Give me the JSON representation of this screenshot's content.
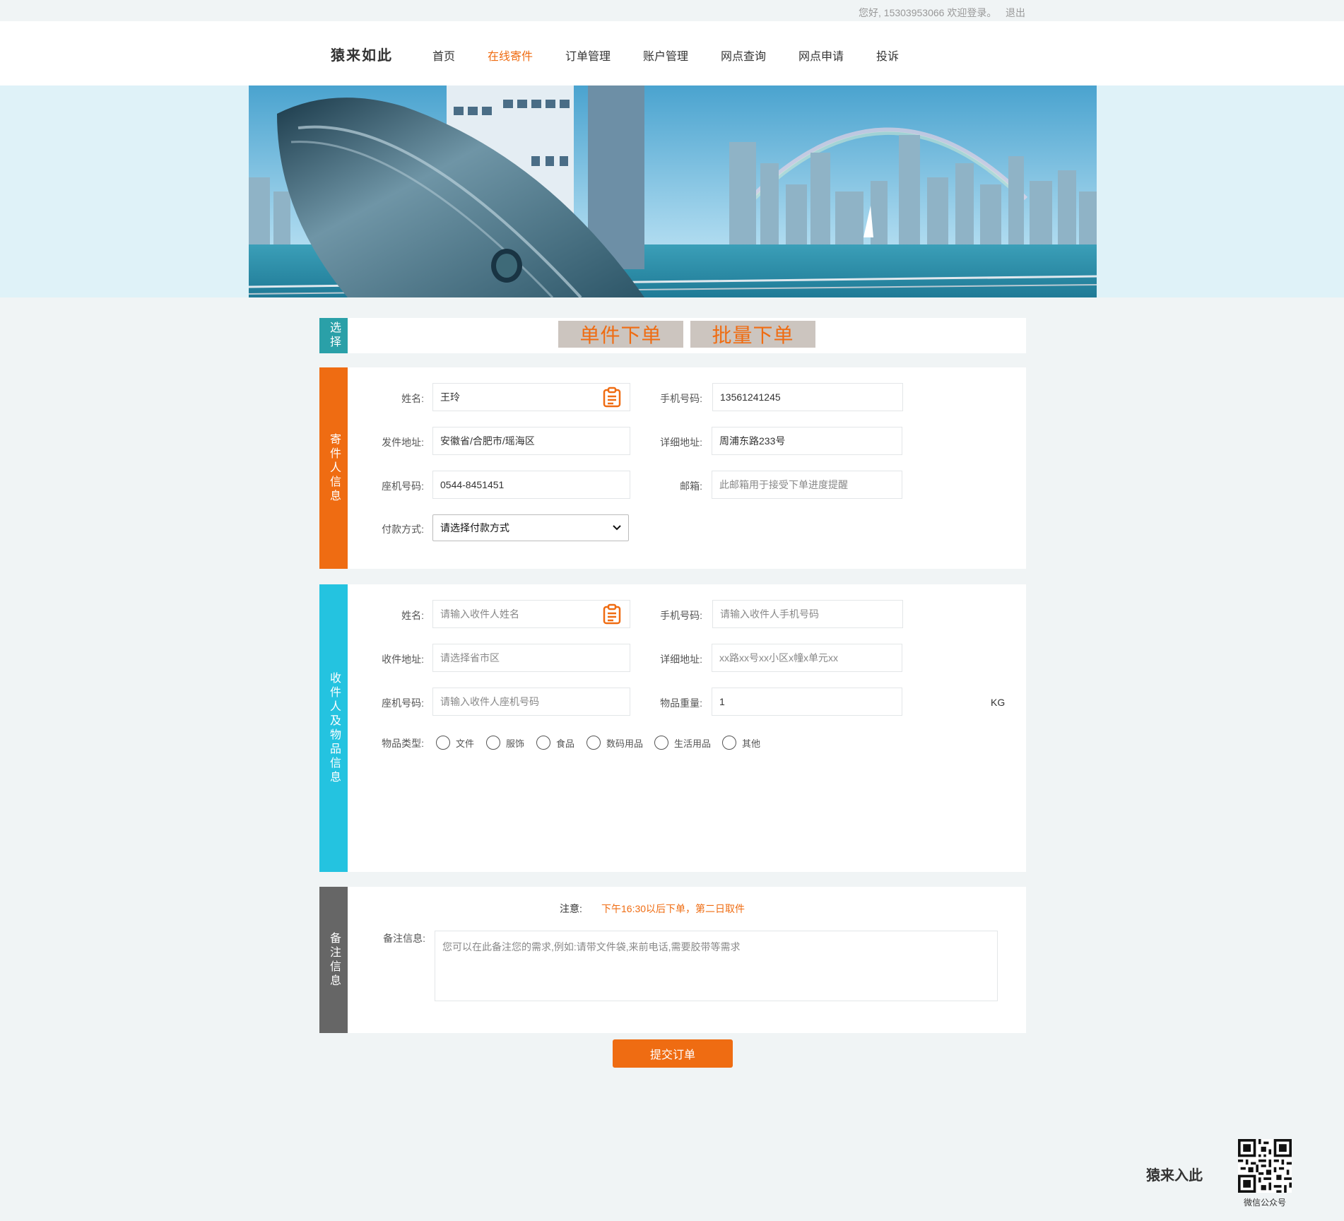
{
  "topbar": {
    "greeting": "您好, 15303953066 欢迎登录。",
    "logout": "退出"
  },
  "logo": "猿来如此",
  "nav": [
    "首页",
    "在线寄件",
    "订单管理",
    "账户管理",
    "网点查询",
    "网点申请",
    "投诉"
  ],
  "nav_active": "在线寄件",
  "choose": {
    "side": "选择",
    "single": "单件下单",
    "batch": "批量下单"
  },
  "sender": {
    "side": "寄件人信息",
    "name_label": "姓名:",
    "name_value": "王玲",
    "phone_label": "手机号码:",
    "phone_value": "13561241245",
    "addr_label": "发件地址:",
    "addr_value": "安徽省/合肥市/瑶海区",
    "detail_label": "详细地址:",
    "detail_value": "周浦东路233号",
    "landline_label": "座机号码:",
    "landline_value": "0544-8451451",
    "email_label": "邮箱:",
    "email_placeholder": "此邮箱用于接受下单进度提醒",
    "pay_label": "付款方式:",
    "pay_value": "请选择付款方式"
  },
  "receiver": {
    "side": "收件人及物品信息",
    "name_label": "姓名:",
    "name_placeholder": "请输入收件人姓名",
    "phone_label": "手机号码:",
    "phone_placeholder": "请输入收件人手机号码",
    "addr_label": "收件地址:",
    "addr_placeholder": "请选择省市区",
    "detail_label": "详细地址:",
    "detail_placeholder": "xx路xx号xx小区x幢x单元xx",
    "landline_label": "座机号码:",
    "landline_placeholder": "请输入收件人座机号码",
    "weight_label": "物品重量:",
    "weight_value": "1",
    "weight_unit": "KG",
    "type_label": "物品类型:",
    "types": [
      "文件",
      "服饰",
      "食品",
      "数码用品",
      "生活用品",
      "其他"
    ]
  },
  "remark": {
    "side": "备注信息",
    "notice_label": "注意:",
    "notice_text": "下午16:30以后下单，第二日取件",
    "label": "备注信息:",
    "placeholder": "您可以在此备注您的需求,例如:请带文件袋,来前电话,需要胶带等需求"
  },
  "submit": "提交订单",
  "footer": {
    "brand": "猿来入此",
    "qr_caption": "微信公众号"
  },
  "colors": {
    "accent": "#ef6c12",
    "teal": "#2aa0a8",
    "cyan": "#24c3e0",
    "gray": "#666666"
  },
  "icons": [
    "clipboard-icon",
    "chevron-down-icon",
    "qr-code-icon"
  ]
}
